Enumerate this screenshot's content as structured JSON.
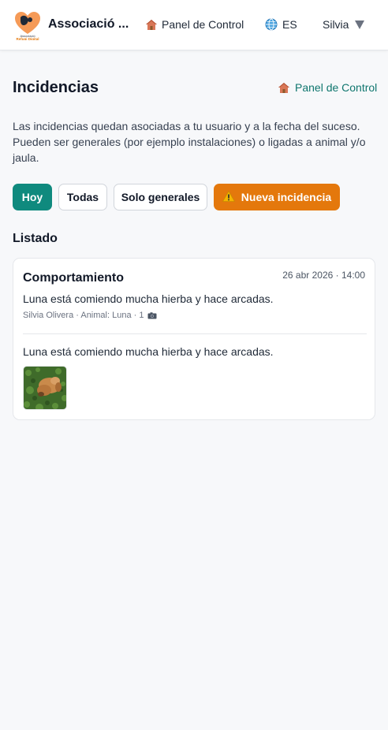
{
  "header": {
    "logo_text": "Associació Refugi Digital",
    "brand": "Associació ...",
    "nav_panel": "Panel de Control",
    "lang": "ES",
    "user": "Silvia"
  },
  "page": {
    "title": "Incidencias",
    "breadcrumb": "Panel de Control",
    "intro": "Las incidencias quedan asociadas a tu usuario y a la fecha del suceso. Pueden ser generales (por ejemplo instalaciones) o ligadas a animal y/o jaula."
  },
  "filters": {
    "hoy": "Hoy",
    "todas": "Todas",
    "generales": "Solo generales",
    "nueva": "Nueva incidencia",
    "active": "Hoy"
  },
  "list": {
    "title": "Listado",
    "items": [
      {
        "category": "Comportamiento",
        "date": "26 abr 2026 · 14:00",
        "summary": "Luna está comiendo mucha hierba y hace arcadas.",
        "meta": "Silvia Olivera · Animal: Luna · 1",
        "body": "Luna está comiendo mucha hierba y hace arcadas.",
        "photos": 1
      }
    ]
  },
  "colors": {
    "accent": "#0f8a7e",
    "warning": "#e4780c",
    "link": "#0f766e"
  },
  "icons": [
    "house-icon",
    "globe-icon",
    "caret-down-icon",
    "warning-icon",
    "camera-icon"
  ]
}
